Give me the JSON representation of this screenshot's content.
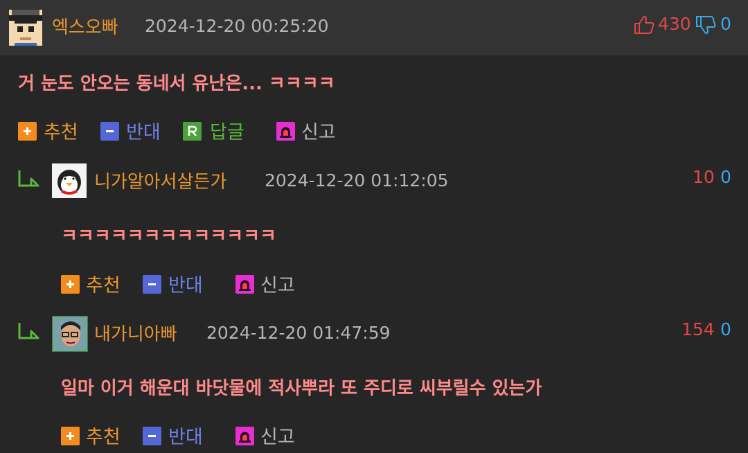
{
  "post": {
    "nickname": "엑스오빠",
    "date": "2024-12-20 00:25:20",
    "upvotes": "430",
    "downvotes": "0",
    "text": "거 눈도 안오는 동네서 유난은... ㅋㅋㅋㅋ",
    "actions": {
      "recommend": "추천",
      "oppose": "반대",
      "reply": "답글",
      "report": "신고"
    }
  },
  "replies": [
    {
      "nickname": "니가알아서살든가",
      "date": "2024-12-20 01:12:05",
      "upvotes": "10",
      "downvotes": "0",
      "text": "ㅋㅋㅋㅋㅋㅋㅋㅋㅋㅋㅋㅋㅋ",
      "actions": {
        "recommend": "추천",
        "oppose": "반대",
        "report": "신고"
      }
    },
    {
      "nickname": "내가니아빠",
      "date": "2024-12-20 01:47:59",
      "upvotes": "154",
      "downvotes": "0",
      "text": "일마 이거 해운대 바닷물에 적사뿌라 또 주디로 씨부릴수 있는가",
      "actions": {
        "recommend": "추천",
        "oppose": "반대",
        "report": "신고"
      }
    }
  ],
  "colors": {
    "nickname": "#e8962f",
    "upvote": "#e04848",
    "downvote": "#3aa7e6",
    "comment_text": "#ff8a8a",
    "recommend_icon": "#f28c1f",
    "oppose_icon": "#5566d8",
    "reply_icon": "#4aa33a",
    "report_icon": "#e62ed1"
  },
  "icons": {
    "post_avatar": "pixel-character-avatar",
    "reply1_avatar": "penguin-avatar",
    "reply2_avatar": "face-photo-avatar",
    "upvote": "thumbs-up-icon",
    "downvote": "thumbs-down-icon",
    "recommend": "plus-icon",
    "oppose": "minus-icon",
    "reply": "r-icon",
    "report": "siren-icon",
    "reply_marker": "reply-arrow-icon"
  }
}
